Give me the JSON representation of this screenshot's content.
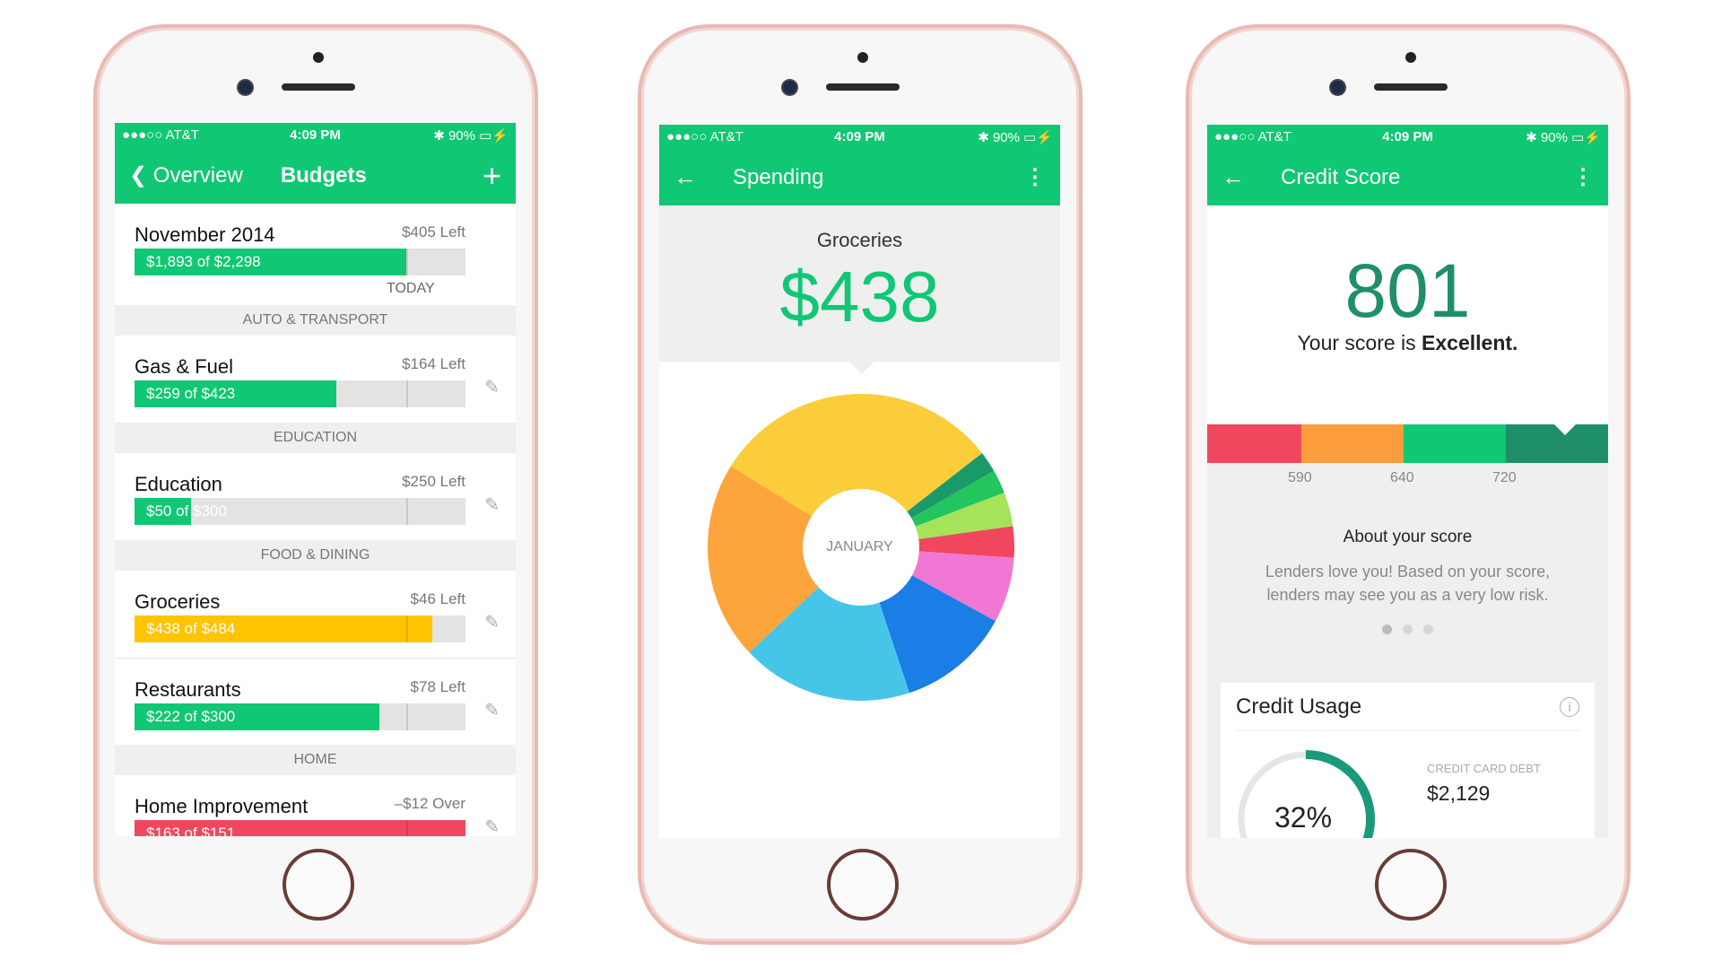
{
  "status": {
    "carrier": "●●●○○ AT&T",
    "time": "4:09 PM",
    "battery": "90%"
  },
  "budgets": {
    "back_label": "Overview",
    "title": "Budgets",
    "add_icon": "plus-icon",
    "summary": {
      "title": "November 2014",
      "left": "$405 Left",
      "bar": "$1,893 of $2,298",
      "progress": 0.82,
      "marker": "TODAY"
    },
    "sections": [
      {
        "header": "AUTO & TRANSPORT",
        "items": [
          {
            "name": "Gas & Fuel",
            "left": "$164 Left",
            "bar": "$259 of $423",
            "progress": 0.61,
            "color": "#10c774"
          }
        ]
      },
      {
        "header": "EDUCATION",
        "items": [
          {
            "name": "Education",
            "left": "$250 Left",
            "bar": "$50 of $300",
            "progress": 0.17,
            "color": "#10c774"
          }
        ]
      },
      {
        "header": "FOOD & DINING",
        "items": [
          {
            "name": "Groceries",
            "left": "$46 Left",
            "bar": "$438 of $484",
            "progress": 0.9,
            "color": "#ffc400"
          },
          {
            "name": "Restaurants",
            "left": "$78 Left",
            "bar": "$222 of $300",
            "progress": 0.74,
            "color": "#10c774"
          }
        ]
      },
      {
        "header": "HOME",
        "items": [
          {
            "name": "Home Improvement",
            "left": "–$12 Over",
            "bar": "$163 of $151",
            "progress": 1.0,
            "color": "#f0475f"
          }
        ]
      }
    ]
  },
  "spending": {
    "title": "Spending",
    "category": "Groceries",
    "amount": "$438",
    "center_label": "JANUARY",
    "chart_data": {
      "type": "pie",
      "slices": [
        {
          "value": 30.6,
          "color": "#fccd3b"
        },
        {
          "value": 2.2,
          "color": "#1a9a6a"
        },
        {
          "value": 2.5,
          "color": "#22c55e"
        },
        {
          "value": 3.6,
          "color": "#a4e35a"
        },
        {
          "value": 3.3,
          "color": "#f0475f"
        },
        {
          "value": 6.9,
          "color": "#f078d4"
        },
        {
          "value": 11.9,
          "color": "#1a7ee6"
        },
        {
          "value": 18.1,
          "color": "#45c6e8"
        },
        {
          "value": 20.9,
          "color": "#fca53c"
        }
      ]
    }
  },
  "credit": {
    "title": "Credit Score",
    "score": "801",
    "phrase": "Your score is ",
    "rating": "Excellent.",
    "scale_colors": [
      "#f0475f",
      "#fc9c3c",
      "#10c774",
      "#1f8f69"
    ],
    "ticks": [
      "590",
      "640",
      "720"
    ],
    "about_title": "About your score",
    "about_text": "Lenders love you! Based on your score, lenders may see you as a very low risk.",
    "card_title": "Credit Usage",
    "usage_pct": "32%",
    "usage": 0.32,
    "debt_label": "CREDIT CARD DEBT",
    "debt_value": "$2,129"
  }
}
